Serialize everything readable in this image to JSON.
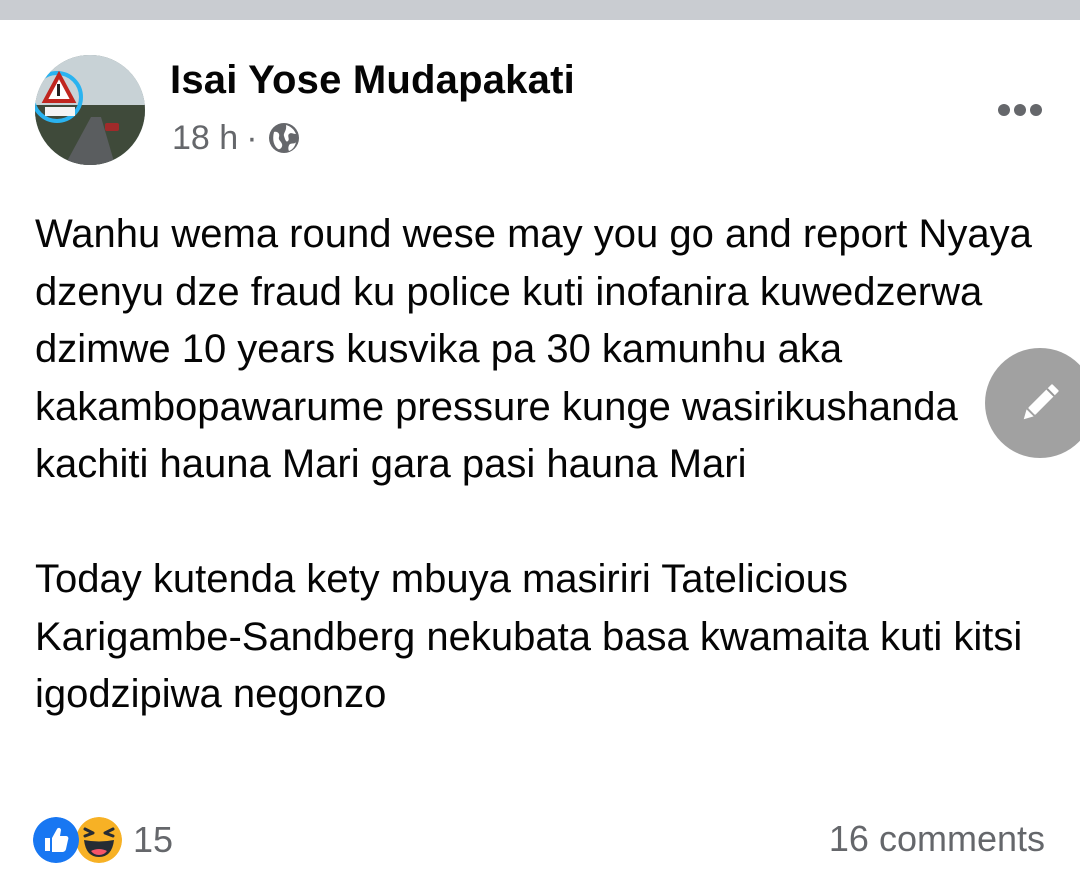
{
  "post": {
    "author": "Isai Yose Mudapakati",
    "time": "18 h",
    "separator": "·",
    "privacy_icon": "globe-icon",
    "paragraphs": [
      "Wanhu wema round wese may you go and report Nyaya dzenyu dze fraud ku police kuti inofanira kuwedzerwa dzimwe 10 years kusvika pa 30 kamunhu aka kakambopawarume pressure kunge wasirikushanda kachiti hauna Mari gara pasi hauna Mari",
      "Today kutenda kety mbuya masiriri Tatelicious Karigambe-Sandberg nekubata basa kwamaita kuti kitsi igodzipiwa negonzo"
    ]
  },
  "footer": {
    "reaction_icons": [
      "like-icon",
      "haha-icon"
    ],
    "reaction_count": "15",
    "comments": "16 comments"
  },
  "colors": {
    "top_bar": "#c9ccd1",
    "text": "#050505",
    "secondary_text": "#65676b",
    "like_blue": "#1877f2",
    "haha_yellow": "#f7b125"
  }
}
